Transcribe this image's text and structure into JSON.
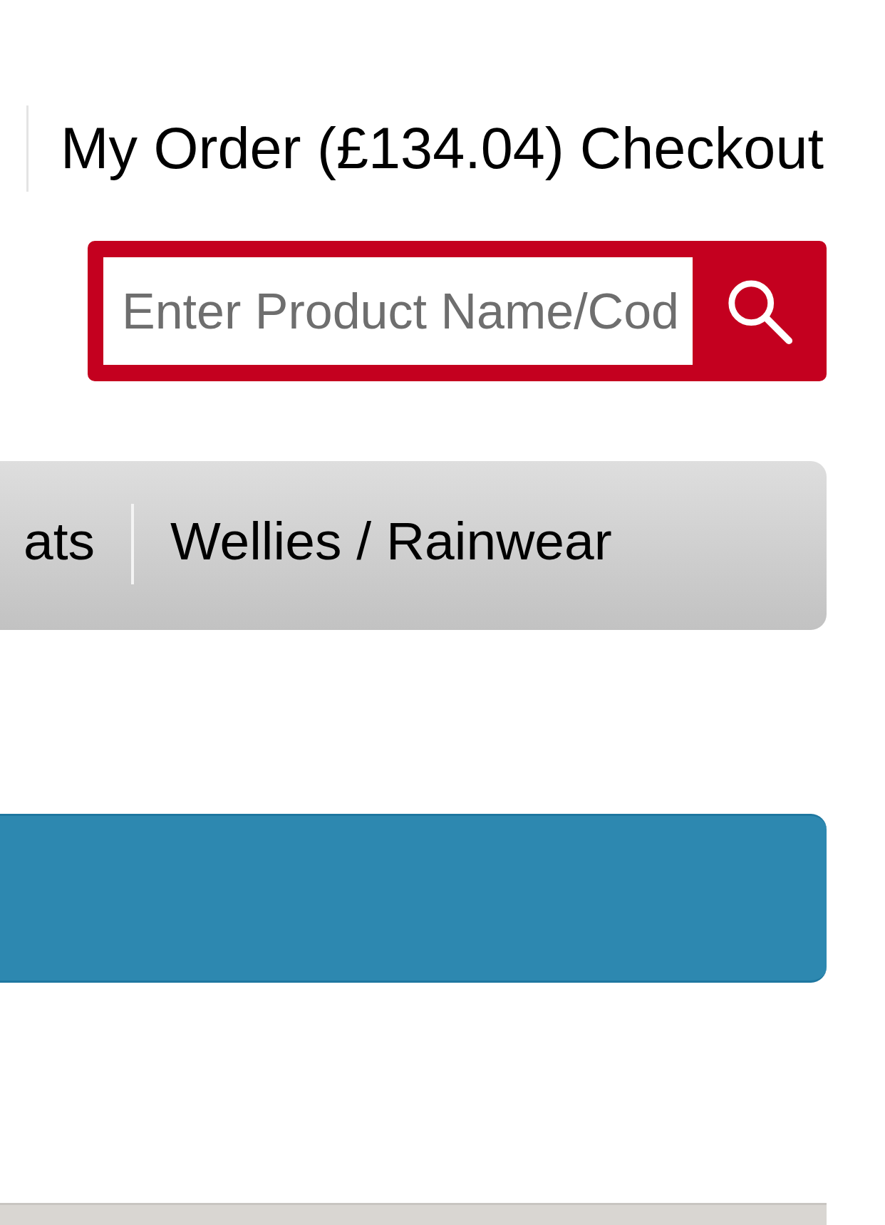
{
  "header": {
    "order_link": "My Order (£134.04)",
    "checkout_link": "Checkout"
  },
  "search": {
    "placeholder": "Enter Product Name/Cod"
  },
  "nav": {
    "items": [
      {
        "label": "ats"
      },
      {
        "label": "Wellies / Rainwear"
      }
    ]
  }
}
